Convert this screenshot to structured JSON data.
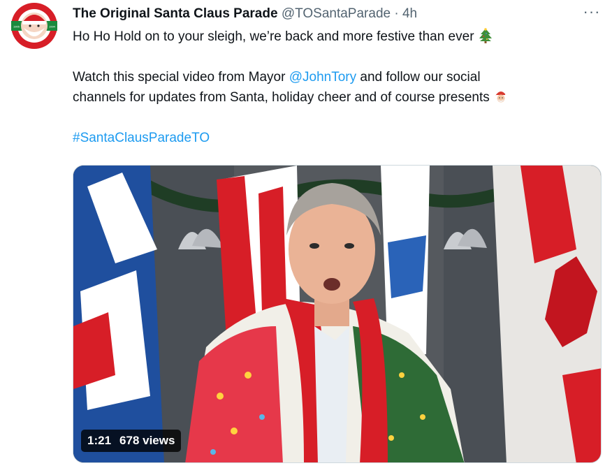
{
  "tweet": {
    "author_name": "The Original Santa Claus Parade",
    "handle": "@TOSantaParade",
    "separator": "·",
    "time": "4h",
    "more_label": "···",
    "line1": "Ho Ho Hold on to your sleigh, we’re back and more festive than ever",
    "line2_prefix": "Watch this special video from Mayor ",
    "mention": "@JohnTory",
    "line2_suffix": " and follow our social",
    "line3": "channels for updates from Santa, holiday cheer and of course presents",
    "hashtag": "#SantaClausParadeTO",
    "emojis": [
      "christmas-tree-icon",
      "santa-icon"
    ]
  },
  "video": {
    "duration": "1:21",
    "views": "678 views"
  },
  "avatar_logo": {
    "top_text": "THE ORIGINAL SANTA CLAUS PARADE",
    "bottom_text": "LE DÉFILÉ ORIGINAL DU PÈRE NOËL",
    "left_year": "1905",
    "right_year": "1994"
  },
  "colors": {
    "text": "#0f1419",
    "secondary": "#536471",
    "link": "#1d9bf0",
    "logo_red": "#d71e27",
    "logo_green": "#1c8a3e"
  }
}
